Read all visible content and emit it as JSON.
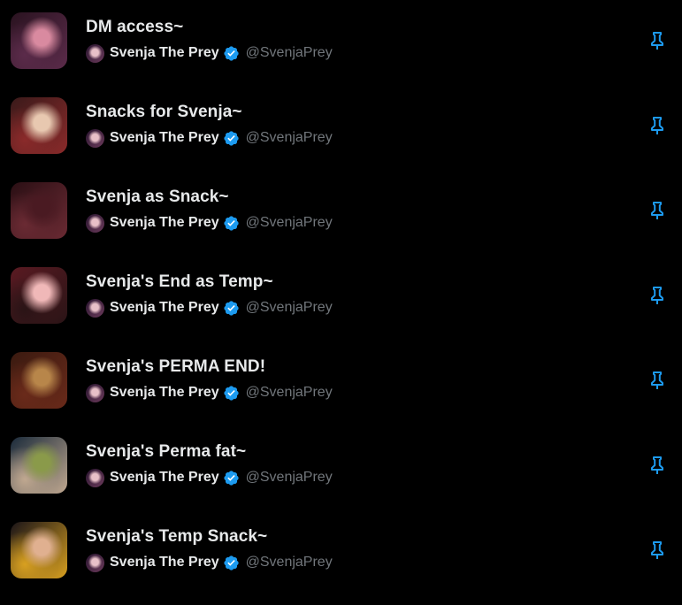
{
  "colors": {
    "background": "#000000",
    "title_text": "#e7e9ea",
    "handle_text": "#71767b",
    "verified_badge": "#1d9bf0",
    "pin_icon": "#1d9bf0"
  },
  "lists": [
    {
      "name": "DM access~",
      "owner_name": "Svenja The Prey",
      "owner_handle": "@SvenjaPrey",
      "thumb_colors": [
        "#2a1320",
        "#d98aa0",
        "#5b2b4a"
      ],
      "verified_icon": "verified-badge",
      "pin_icon": "pin"
    },
    {
      "name": "Snacks for Svenja~",
      "owner_name": "Svenja The Prey",
      "owner_handle": "@SvenjaPrey",
      "thumb_colors": [
        "#3a1a1a",
        "#e8c8b0",
        "#8a2a2a"
      ],
      "verified_icon": "verified-badge",
      "pin_icon": "pin"
    },
    {
      "name": "Svenja as Snack~",
      "owner_name": "Svenja The Prey",
      "owner_handle": "@SvenjaPrey",
      "thumb_colors": [
        "#2a0f14",
        "#4a1a22",
        "#6a2a33"
      ],
      "verified_icon": "verified-badge",
      "pin_icon": "pin"
    },
    {
      "name": "Svenja's End as Temp~",
      "owner_name": "Svenja The Prey",
      "owner_handle": "@SvenjaPrey",
      "thumb_colors": [
        "#5a1a22",
        "#f0b8b8",
        "#2a1416"
      ],
      "verified_icon": "verified-badge",
      "pin_icon": "pin"
    },
    {
      "name": "Svenja's PERMA END!",
      "owner_name": "Svenja The Prey",
      "owner_handle": "@SvenjaPrey",
      "thumb_colors": [
        "#3a1a10",
        "#b8864a",
        "#6a2a1a"
      ],
      "verified_icon": "verified-badge",
      "pin_icon": "pin"
    },
    {
      "name": "Svenja's Perma fat~",
      "owner_name": "Svenja The Prey",
      "owner_handle": "@SvenjaPrey",
      "thumb_colors": [
        "#1a2a3a",
        "#8a9a4a",
        "#c0a890"
      ],
      "verified_icon": "verified-badge",
      "pin_icon": "pin"
    },
    {
      "name": "Svenja's Temp Snack~",
      "owner_name": "Svenja The Prey",
      "owner_handle": "@SvenjaPrey",
      "thumb_colors": [
        "#1a1418",
        "#e0b090",
        "#d8a020"
      ],
      "verified_icon": "verified-badge",
      "pin_icon": "pin"
    }
  ]
}
